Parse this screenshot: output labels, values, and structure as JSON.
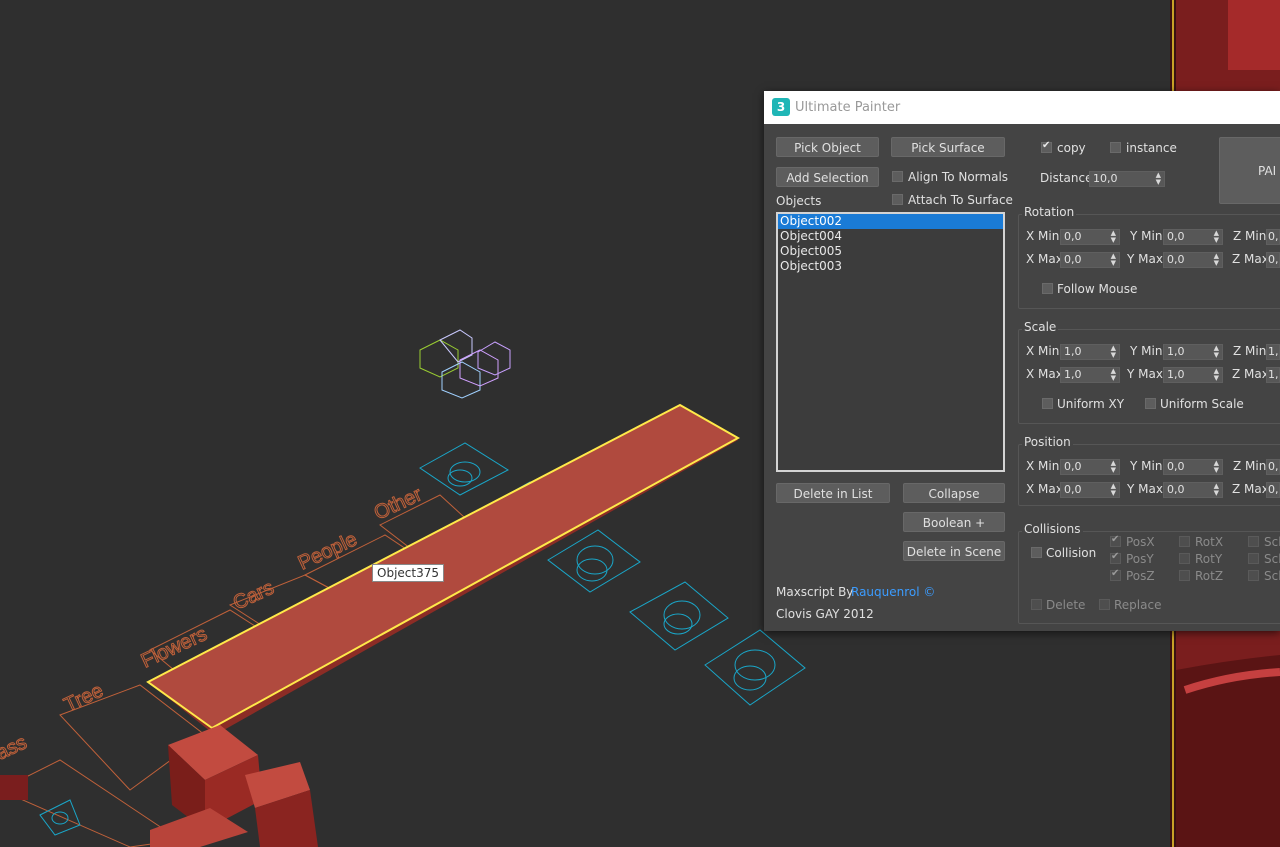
{
  "viewport": {
    "labels": [
      "ass",
      "Tree",
      "Flowers",
      "Cars",
      "People",
      "Other"
    ],
    "tooltip": "Object375"
  },
  "dialog": {
    "title": "Ultimate Painter",
    "logo_glyph": "3",
    "buttons": {
      "pick_object": "Pick Object",
      "pick_surface": "Pick Surface",
      "add_selection": "Add Selection",
      "delete_in_list": "Delete in List",
      "collapse": "Collapse",
      "boolean": "Boolean +",
      "delete_in_scene": "Delete in Scene",
      "paint": "PAI"
    },
    "options": {
      "align_to_normals": "Align To Normals",
      "attach_to_surface": "Attach To Surface",
      "copy": "copy",
      "instance": "instance",
      "distance_label": "Distance",
      "distance_value": "10,0"
    },
    "objects": {
      "label": "Objects",
      "items": [
        "Object002",
        "Object004",
        "Object005",
        "Object003"
      ],
      "selected_index": 0
    },
    "rotation": {
      "title": "Rotation",
      "x_min_label": "X Min",
      "x_min": "0,0",
      "y_min_label": "Y Min",
      "y_min": "0,0",
      "z_min_label": "Z Min",
      "z_min": "0,",
      "x_max_label": "X Max",
      "x_max": "0,0",
      "y_max_label": "Y Max",
      "y_max": "0,0",
      "z_max_label": "Z Max",
      "z_max": "0,",
      "follow_mouse": "Follow Mouse"
    },
    "scale": {
      "title": "Scale",
      "x_min_label": "X Min",
      "x_min": "1,0",
      "y_min_label": "Y Min",
      "y_min": "1,0",
      "z_min_label": "Z Min",
      "z_min": "1,",
      "x_max_label": "X Max",
      "x_max": "1,0",
      "y_max_label": "Y Max",
      "y_max": "1,0",
      "z_max_label": "Z Max",
      "z_max": "1,",
      "uniform_xy": "Uniform XY",
      "uniform_scale": "Uniform Scale"
    },
    "position": {
      "title": "Position",
      "x_min_label": "X Min",
      "x_min": "0,0",
      "y_min_label": "Y Min",
      "y_min": "0,0",
      "z_min_label": "Z Min",
      "z_min": "0,",
      "x_max_label": "X Max",
      "x_max": "0,0",
      "y_max_label": "Y Max",
      "y_max": "0,0",
      "z_max_label": "Z Max",
      "z_max": "0,"
    },
    "collisions": {
      "title": "Collisions",
      "collision": "Collision",
      "pos_x": "PosX",
      "pos_y": "PosY",
      "pos_z": "PosZ",
      "rot_x": "RotX",
      "rot_y": "RotY",
      "rot_z": "RotZ",
      "scl": "Scl",
      "delete": "Delete",
      "replace": "Replace"
    },
    "credits": {
      "maxscript_by": "Maxscript By",
      "author_link": "Rauquenrol ©",
      "line2": "Clovis GAY 2012"
    }
  }
}
